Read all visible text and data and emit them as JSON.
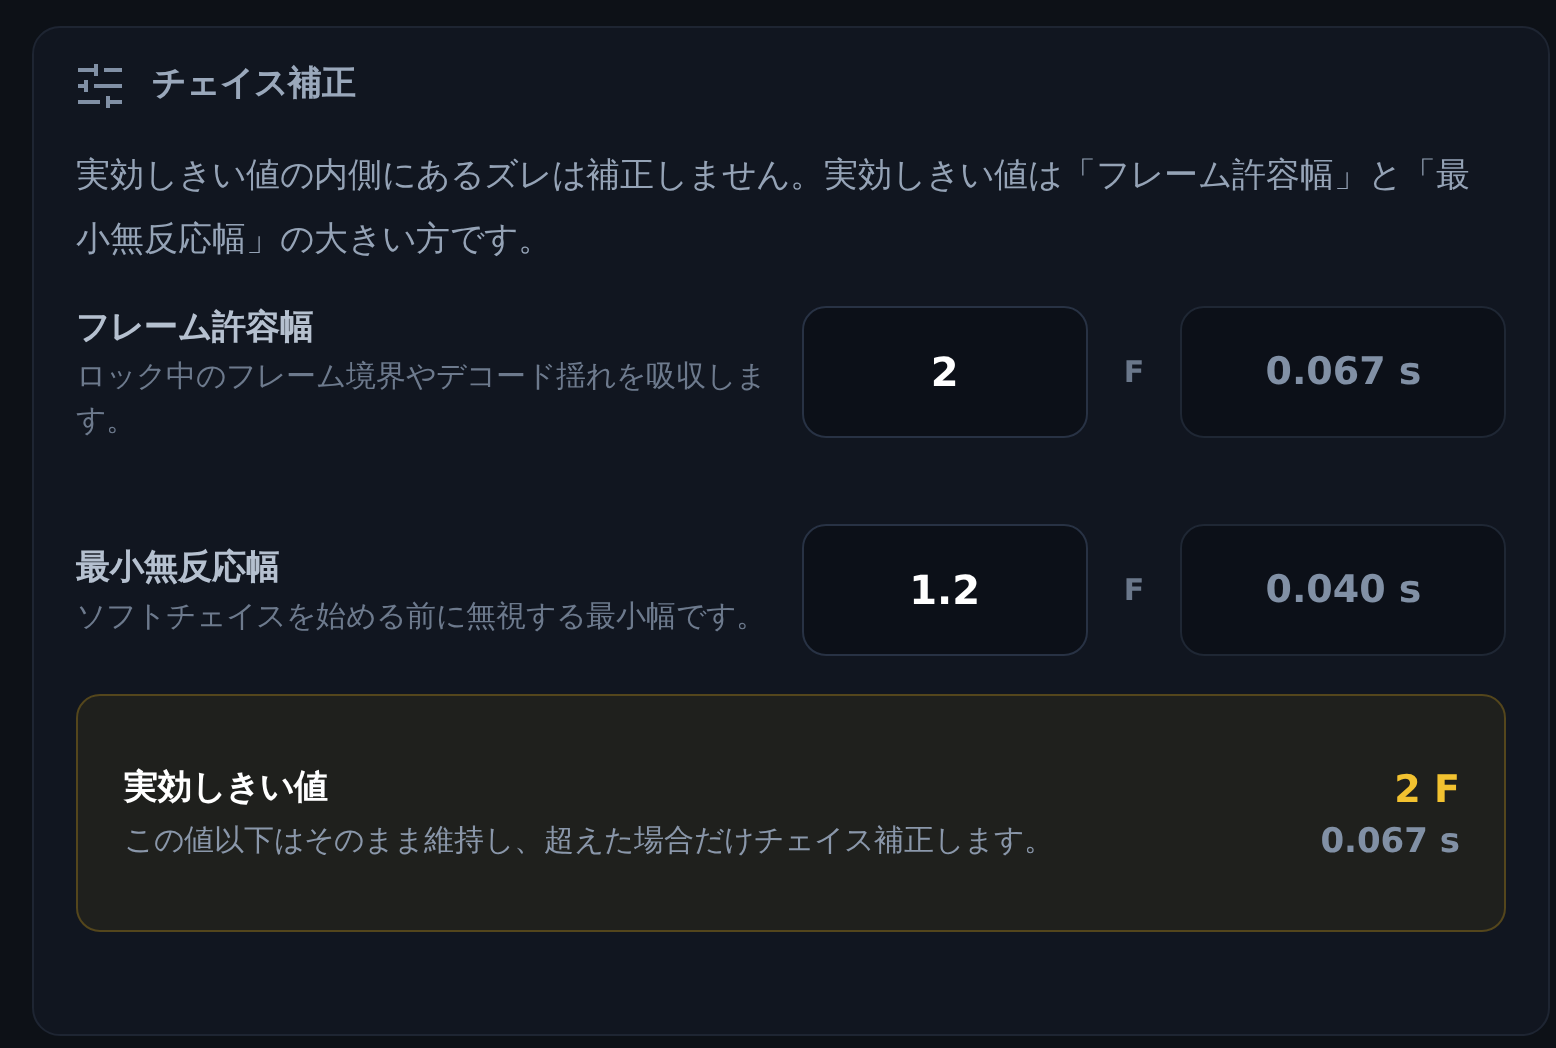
{
  "section": {
    "title": "チェイス補正",
    "description": "実効しきい値の内側にあるズレは補正しません。実効しきい値は「フレーム許容幅」と「最小無反応幅」の大きい方です。"
  },
  "settings": [
    {
      "label": "フレーム許容幅",
      "hint": "ロック中のフレーム境界やデコード揺れを吸収します。",
      "value": "2",
      "unit": "F",
      "seconds": "0.067 s"
    },
    {
      "label": "最小無反応幅",
      "hint": "ソフトチェイスを始める前に無視する最小幅です。",
      "value": "1.2",
      "unit": "F",
      "seconds": "0.040 s"
    }
  ],
  "result": {
    "title": "実効しきい値",
    "description": "この値以下はそのまま維持し、超えた場合だけチェイス補正します。",
    "frames": "2 F",
    "seconds": "0.067 s"
  }
}
